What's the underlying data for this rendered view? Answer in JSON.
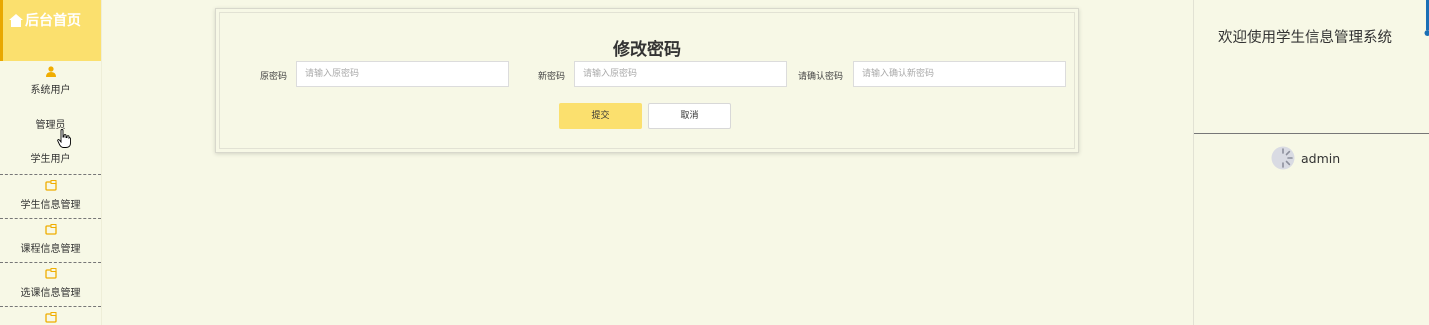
{
  "sidebar": {
    "home_label": "后台首页",
    "items": [
      {
        "label": "系统用户",
        "icon": "user-icon"
      },
      {
        "label": "管理员"
      },
      {
        "label": "学生用户"
      },
      {
        "label": "学生信息管理",
        "icon": "folder-icon"
      },
      {
        "label": "课程信息管理",
        "icon": "folder-icon"
      },
      {
        "label": "选课信息管理",
        "icon": "folder-icon"
      }
    ]
  },
  "form": {
    "title": "修改密码",
    "old_password": {
      "label": "原密码",
      "placeholder": "请输入原密码"
    },
    "new_password": {
      "label": "新密码",
      "placeholder": "请输入原密码"
    },
    "confirm_password": {
      "label": "请确认密码",
      "placeholder": "请输入确认新密码"
    },
    "submit_label": "提交",
    "cancel_label": "取消"
  },
  "right_panel": {
    "welcome": "欢迎使用学生信息管理系统",
    "username": "admin"
  },
  "colors": {
    "accent": "#fbe06e",
    "accent_border": "#e9a800",
    "icon": "#f0ad00",
    "background": "#f7f8e6"
  }
}
